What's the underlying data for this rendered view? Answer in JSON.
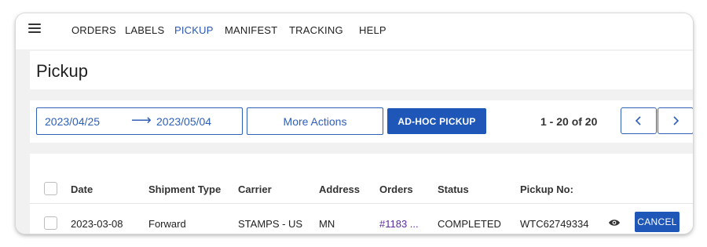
{
  "nav": {
    "items": [
      {
        "label": "ORDERS"
      },
      {
        "label": "LABELS"
      },
      {
        "label": "PICKUP"
      },
      {
        "label": "MANIFEST"
      },
      {
        "label": "TRACKING"
      },
      {
        "label": "HELP"
      }
    ],
    "active": "PICKUP",
    "accent_color": "#2a57b0"
  },
  "page": {
    "title": "Pickup"
  },
  "toolbar": {
    "date_from": "2023/04/25",
    "date_arrow": "⟶",
    "date_to": "2023/05/04",
    "more_actions_label": "More Actions",
    "adhoc_label": "AD-HOC PICKUP",
    "pager_text": "1 - 20 of 20",
    "prev_icon": "chevron-left-icon",
    "next_icon": "chevron-right-icon"
  },
  "table": {
    "columns": [
      "Date",
      "Shipment Type",
      "Carrier",
      "Address",
      "Orders",
      "Status",
      "Pickup No:"
    ],
    "rows": [
      {
        "date": "2023-03-08",
        "shipment_type": "Forward",
        "carrier": "STAMPS - US",
        "address": "MN",
        "orders": "#1183 ...",
        "status": "COMPLETED",
        "pickup_no": "WTC62749334",
        "view_icon": "eye-icon",
        "cancel_label": "CANCEL"
      }
    ]
  },
  "colors": {
    "primary": "#1f57b8",
    "outline": "#2f5fb7",
    "link": "#5b2a9e"
  }
}
